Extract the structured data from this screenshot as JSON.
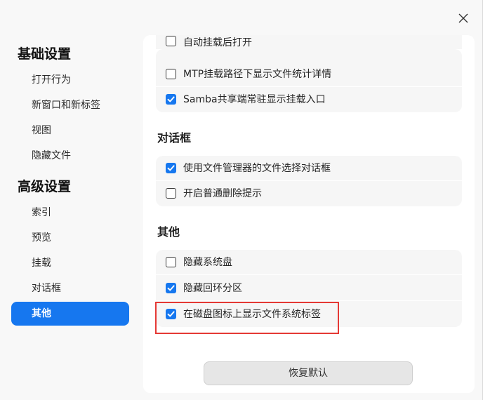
{
  "window": {
    "close_icon": "close-icon"
  },
  "sidebar": {
    "groups": [
      {
        "title": "基础设置",
        "items": [
          "打开行为",
          "新窗口和新标签",
          "视图",
          "隐藏文件"
        ]
      },
      {
        "title": "高级设置",
        "items": [
          "索引",
          "预览",
          "挂载",
          "对话框",
          "其他"
        ]
      }
    ],
    "active_item": "其他",
    "accent": "#1677ef"
  },
  "content": {
    "partial_item": {
      "label": "自动挂载后打开",
      "checked": false
    },
    "mount_card": [
      {
        "label": "MTP挂载路径下显示文件统计详情",
        "checked": false
      },
      {
        "label": "Samba共享端常驻显示挂载入口",
        "checked": true
      }
    ],
    "dialog_section": {
      "title": "对话框",
      "items": [
        {
          "label": "使用文件管理器的文件选择对话框",
          "checked": true
        },
        {
          "label": "开启普通删除提示",
          "checked": false
        }
      ]
    },
    "other_section": {
      "title": "其他",
      "items": [
        {
          "label": "隐藏系统盘",
          "checked": false
        },
        {
          "label": "隐藏回环分区",
          "checked": true
        },
        {
          "label": "在磁盘图标上显示文件系统标签",
          "checked": true
        }
      ]
    },
    "restore_label": "恢复默认",
    "highlight_color": "#e53935"
  }
}
